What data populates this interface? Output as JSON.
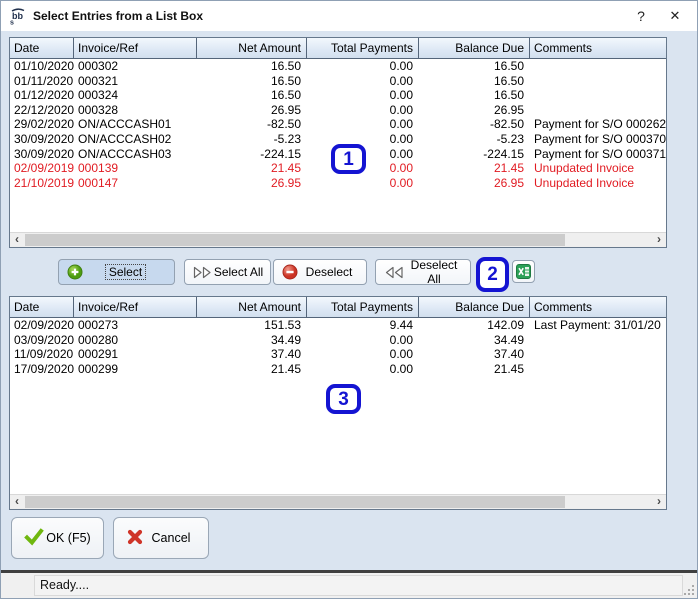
{
  "window": {
    "title": "Select Entries from a List Box",
    "help": "?",
    "close": "✕"
  },
  "columns": [
    "Date",
    "Invoice/Ref",
    "Net Amount",
    "Total Payments",
    "Balance Due",
    "Comments"
  ],
  "available_table": {
    "rows": [
      {
        "date": "01/10/2020",
        "ref": "000302",
        "net": "16.50",
        "payments": "0.00",
        "balance": "16.50",
        "comments": "",
        "red": false
      },
      {
        "date": "01/11/2020",
        "ref": "000321",
        "net": "16.50",
        "payments": "0.00",
        "balance": "16.50",
        "comments": "",
        "red": false
      },
      {
        "date": "01/12/2020",
        "ref": "000324",
        "net": "16.50",
        "payments": "0.00",
        "balance": "16.50",
        "comments": "",
        "red": false
      },
      {
        "date": "22/12/2020",
        "ref": "000328",
        "net": "26.95",
        "payments": "0.00",
        "balance": "26.95",
        "comments": "",
        "red": false
      },
      {
        "date": "29/02/2020",
        "ref": "ON/ACCCASH01",
        "net": "-82.50",
        "payments": "0.00",
        "balance": "-82.50",
        "comments": "Payment for S/O 000262",
        "red": false
      },
      {
        "date": "30/09/2020",
        "ref": "ON/ACCCASH02",
        "net": "-5.23",
        "payments": "0.00",
        "balance": "-5.23",
        "comments": "Payment for S/O 000370",
        "red": false
      },
      {
        "date": "30/09/2020",
        "ref": "ON/ACCCASH03",
        "net": "-224.15",
        "payments": "0.00",
        "balance": "-224.15",
        "comments": "Payment for S/O 000371",
        "red": false
      },
      {
        "date": "02/09/2019",
        "ref": "000139",
        "net": "21.45",
        "payments": "0.00",
        "balance": "21.45",
        "comments": "Unupdated Invoice",
        "red": true
      },
      {
        "date": "21/10/2019",
        "ref": "000147",
        "net": "26.95",
        "payments": "0.00",
        "balance": "26.95",
        "comments": "Unupdated Invoice",
        "red": true
      }
    ]
  },
  "selected_table": {
    "rows": [
      {
        "date": "02/09/2020",
        "ref": "000273",
        "net": "151.53",
        "payments": "9.44",
        "balance": "142.09",
        "comments": "Last Payment: 31/01/20",
        "red": false
      },
      {
        "date": "03/09/2020",
        "ref": "000280",
        "net": "34.49",
        "payments": "0.00",
        "balance": "34.49",
        "comments": "",
        "red": false
      },
      {
        "date": "11/09/2020",
        "ref": "000291",
        "net": "37.40",
        "payments": "0.00",
        "balance": "37.40",
        "comments": "",
        "red": false
      },
      {
        "date": "17/09/2020",
        "ref": "000299",
        "net": "21.45",
        "payments": "0.00",
        "balance": "21.45",
        "comments": "",
        "red": false
      }
    ]
  },
  "toolbar": {
    "select": "Select",
    "select_all": "Select All",
    "deselect": "Deselect",
    "deselect_all": "Deselect All"
  },
  "footer": {
    "ok": "OK (F5)",
    "cancel": "Cancel"
  },
  "statusbar": {
    "text": "Ready...."
  },
  "annotations": [
    {
      "label": "1"
    },
    {
      "label": "2"
    },
    {
      "label": "3"
    }
  ],
  "icons": {
    "select": "plus-circle-icon",
    "select_all": "double-chevron-right-icon",
    "deselect": "minus-circle-icon",
    "deselect_all": "double-chevron-left-icon",
    "excel_export": "excel-icon",
    "ok": "green-check-icon",
    "cancel": "red-cross-icon"
  },
  "colors": {
    "annotation_blue": "#1414d2",
    "error_red": "#e11b22",
    "dialog_background": "#dae4f0",
    "select_green": "#56a313",
    "deselect_red": "#d4382a",
    "excel_green": "#2ca158"
  }
}
